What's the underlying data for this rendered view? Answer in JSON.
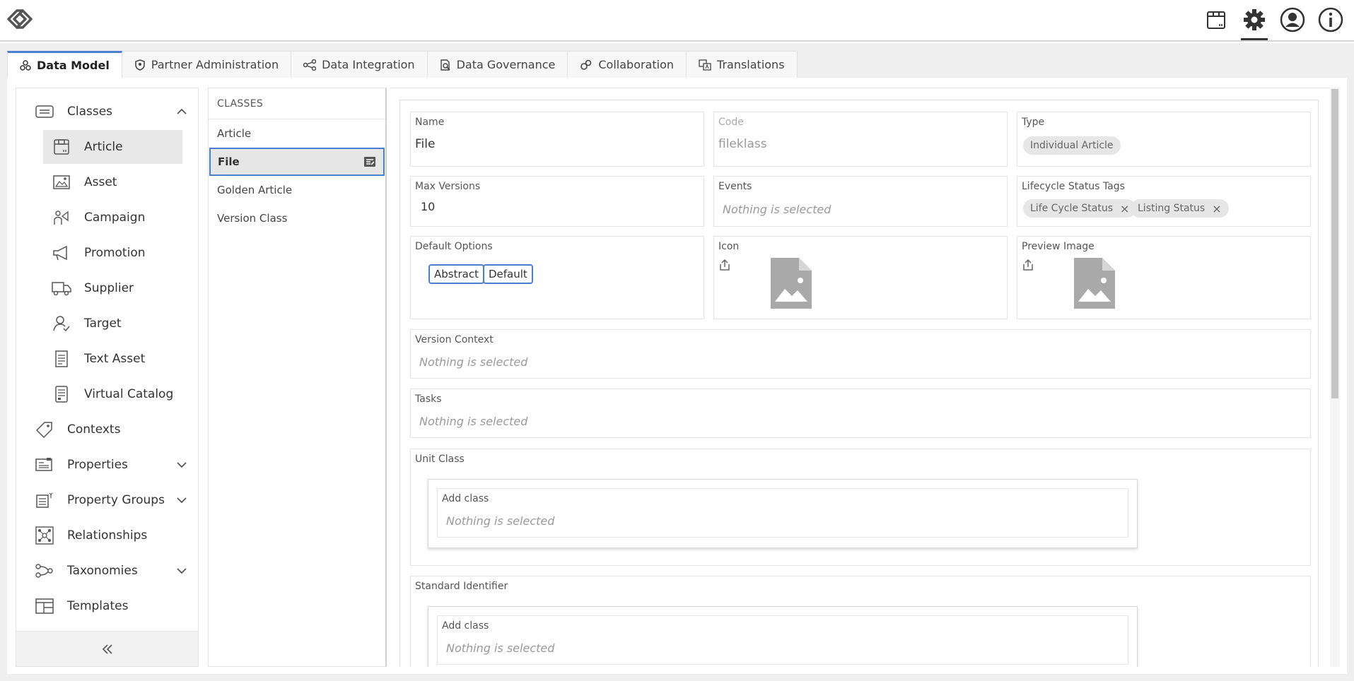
{
  "topbar": {
    "icons": [
      "article-icon",
      "gear-icon",
      "user-icon",
      "info-icon"
    ],
    "active_icon": "gear-icon"
  },
  "tabs": [
    {
      "label": "Data Model",
      "icon": "data-model-icon",
      "active": true
    },
    {
      "label": "Partner Administration",
      "icon": "shield-icon",
      "active": false
    },
    {
      "label": "Data Integration",
      "icon": "integration-icon",
      "active": false
    },
    {
      "label": "Data Governance",
      "icon": "governance-icon",
      "active": false
    },
    {
      "label": "Collaboration",
      "icon": "collaboration-icon",
      "active": false
    },
    {
      "label": "Translations",
      "icon": "translations-icon",
      "active": false
    }
  ],
  "sidebar": {
    "items": [
      {
        "label": "Classes",
        "icon": "classes-icon",
        "expanded": true
      },
      {
        "label": "Article",
        "icon": "article-icon",
        "selected": true
      },
      {
        "label": "Asset",
        "icon": "asset-icon"
      },
      {
        "label": "Campaign",
        "icon": "campaign-icon"
      },
      {
        "label": "Promotion",
        "icon": "promotion-icon"
      },
      {
        "label": "Supplier",
        "icon": "supplier-icon"
      },
      {
        "label": "Target",
        "icon": "target-icon"
      },
      {
        "label": "Text Asset",
        "icon": "text-asset-icon"
      },
      {
        "label": "Virtual Catalog",
        "icon": "virtual-catalog-icon"
      },
      {
        "label": "Contexts",
        "icon": "contexts-icon"
      },
      {
        "label": "Properties",
        "icon": "properties-icon",
        "expandable": true
      },
      {
        "label": "Property Groups",
        "icon": "property-groups-icon",
        "expandable": true
      },
      {
        "label": "Relationships",
        "icon": "relationships-icon"
      },
      {
        "label": "Taxonomies",
        "icon": "taxonomies-icon",
        "expandable": true
      },
      {
        "label": "Templates",
        "icon": "templates-icon"
      }
    ],
    "collapse_icon": "double-chevron-left-icon"
  },
  "classlist": {
    "header": "CLASSES",
    "items": [
      {
        "label": "Article"
      },
      {
        "label": "File",
        "selected": true
      },
      {
        "label": "Golden Article"
      },
      {
        "label": "Version Class"
      }
    ]
  },
  "detail": {
    "name": {
      "label": "Name",
      "value": "File"
    },
    "code": {
      "label": "Code",
      "value": "fileklass"
    },
    "type": {
      "label": "Type",
      "value": "Individual Article"
    },
    "max_versions": {
      "label": "Max Versions",
      "value": "10"
    },
    "events": {
      "label": "Events",
      "placeholder": "Nothing is selected"
    },
    "lifecycle": {
      "label": "Lifecycle Status Tags",
      "tags": [
        "Life Cycle Status",
        "Listing Status"
      ]
    },
    "default_options": {
      "label": "Default Options",
      "options": [
        "Abstract",
        "Default"
      ]
    },
    "icon": {
      "label": "Icon"
    },
    "preview_image": {
      "label": "Preview Image"
    },
    "version_context": {
      "label": "Version Context",
      "placeholder": "Nothing is selected"
    },
    "tasks": {
      "label": "Tasks",
      "placeholder": "Nothing is selected"
    },
    "unit_class": {
      "label": "Unit Class",
      "add_label": "Add class",
      "placeholder": "Nothing is selected"
    },
    "standard_identifier": {
      "label": "Standard Identifier",
      "add_label": "Add class",
      "placeholder": "Nothing is selected"
    }
  },
  "colors": {
    "accent": "#4a7fd0",
    "selected_bg": "#e6e6e6"
  }
}
